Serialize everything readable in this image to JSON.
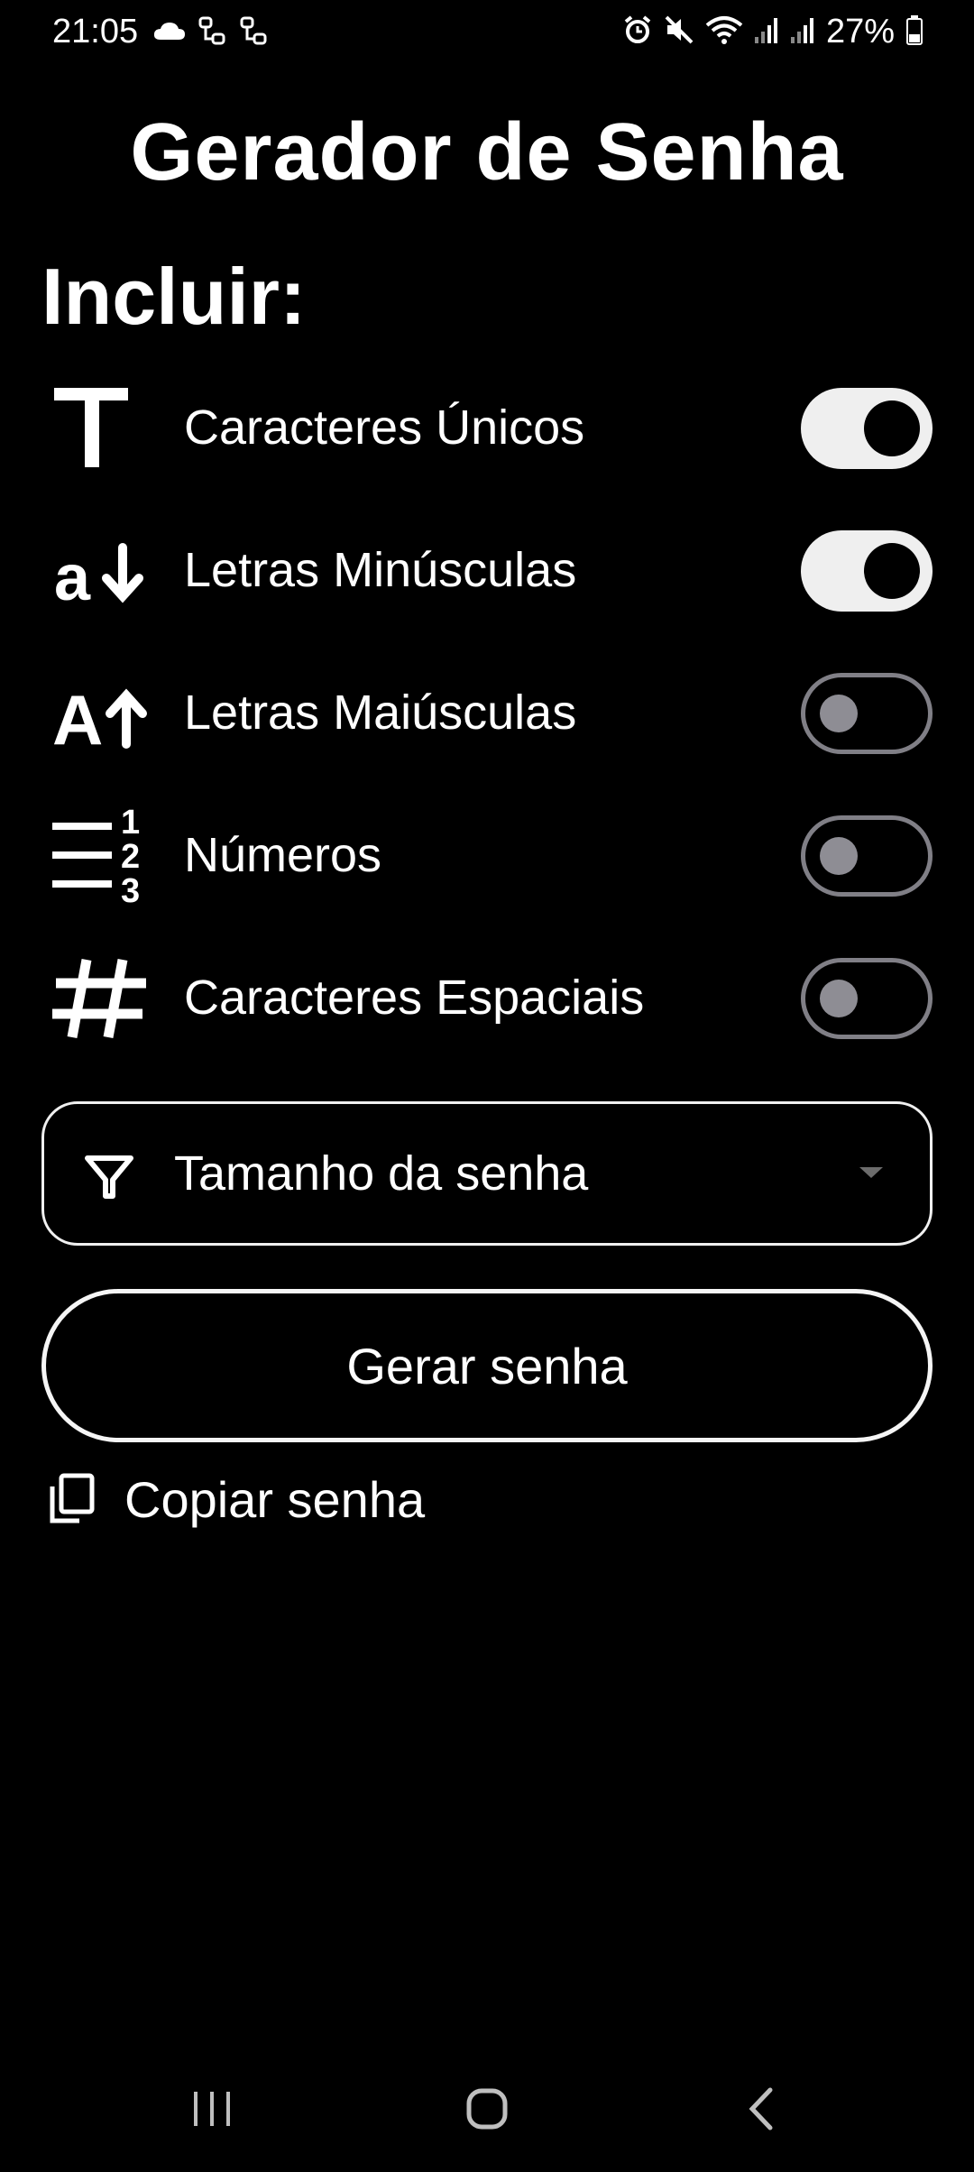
{
  "status_bar": {
    "time": "21:05",
    "battery_percent": "27%",
    "left_icons": [
      "cloud-icon",
      "link-icon",
      "link-icon"
    ],
    "right_icons": [
      "alarm-icon",
      "mute-icon",
      "wifi-icon",
      "signal-icon",
      "signal-icon",
      "battery-icon"
    ]
  },
  "app": {
    "title": "Gerador de Senha",
    "section_title": "Incluir:"
  },
  "options": [
    {
      "label": "Caracteres Únicos",
      "icon": "text-T-icon",
      "enabled": true
    },
    {
      "label": "Letras Minúsculas",
      "icon": "lowercase-icon",
      "enabled": true
    },
    {
      "label": "Letras Maiúsculas",
      "icon": "uppercase-icon",
      "enabled": false
    },
    {
      "label": "Números",
      "icon": "numbered-list-icon",
      "enabled": false
    },
    {
      "label": "Caracteres Espaciais",
      "icon": "hash-icon",
      "enabled": false
    }
  ],
  "length_dropdown": {
    "label": "Tamanho da senha",
    "icon": "filter-icon"
  },
  "generate_button": {
    "label": "Gerar senha"
  },
  "copy": {
    "label": "Copiar senha",
    "icon": "copy-icon"
  },
  "nav": {
    "icons": [
      "recents-icon",
      "home-icon",
      "back-icon"
    ]
  },
  "colors": {
    "background": "#000000",
    "text": "#ffffff",
    "toggle_on_track": "#efefef",
    "toggle_off_border": "#807f86",
    "toggle_off_knob": "#8e8d94"
  }
}
